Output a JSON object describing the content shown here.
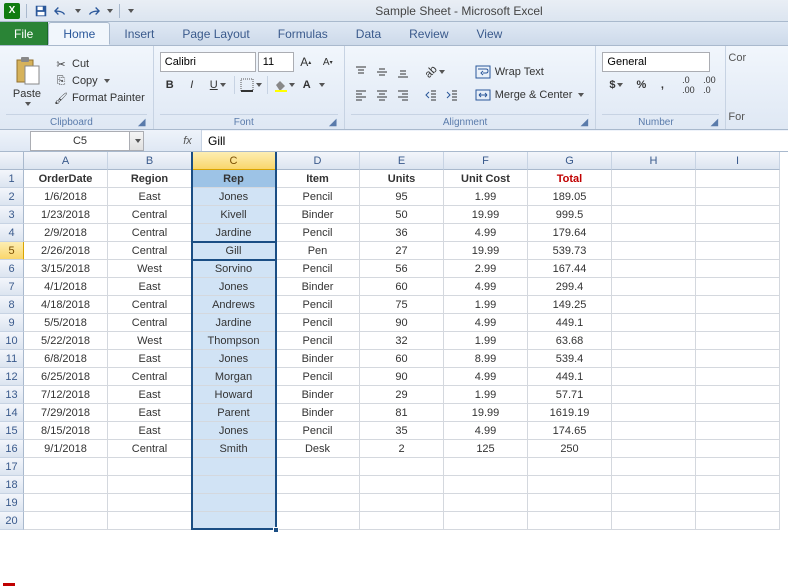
{
  "title": "Sample Sheet - Microsoft Excel",
  "tabs": {
    "file": "File",
    "items": [
      "Home",
      "Insert",
      "Page Layout",
      "Formulas",
      "Data",
      "Review",
      "View"
    ],
    "active": "Home"
  },
  "ribbon": {
    "clipboard": {
      "paste": "Paste",
      "cut": "Cut",
      "copy": "Copy",
      "format_painter": "Format Painter",
      "label": "Clipboard"
    },
    "font": {
      "name": "Calibri",
      "size": "11",
      "label": "Font"
    },
    "alignment": {
      "wrap": "Wrap Text",
      "merge": "Merge & Center",
      "label": "Alignment"
    },
    "number": {
      "format": "General",
      "label": "Number"
    }
  },
  "formula_bar": {
    "name_box": "C5",
    "fx": "fx",
    "value": "Gill"
  },
  "columns": [
    "A",
    "B",
    "C",
    "D",
    "E",
    "F",
    "G",
    "H",
    "I"
  ],
  "row_count": 20,
  "selected_col_index": 2,
  "active_cell": {
    "row": 5,
    "col": 2
  },
  "headers": [
    "OrderDate",
    "Region",
    "Rep",
    "Item",
    "Units",
    "Unit Cost",
    "Total"
  ],
  "total_header_red": true,
  "rows": [
    [
      "1/6/2018",
      "East",
      "Jones",
      "Pencil",
      "95",
      "1.99",
      "189.05"
    ],
    [
      "1/23/2018",
      "Central",
      "Kivell",
      "Binder",
      "50",
      "19.99",
      "999.5"
    ],
    [
      "2/9/2018",
      "Central",
      "Jardine",
      "Pencil",
      "36",
      "4.99",
      "179.64"
    ],
    [
      "2/26/2018",
      "Central",
      "Gill",
      "Pen",
      "27",
      "19.99",
      "539.73"
    ],
    [
      "3/15/2018",
      "West",
      "Sorvino",
      "Pencil",
      "56",
      "2.99",
      "167.44"
    ],
    [
      "4/1/2018",
      "East",
      "Jones",
      "Binder",
      "60",
      "4.99",
      "299.4"
    ],
    [
      "4/18/2018",
      "Central",
      "Andrews",
      "Pencil",
      "75",
      "1.99",
      "149.25"
    ],
    [
      "5/5/2018",
      "Central",
      "Jardine",
      "Pencil",
      "90",
      "4.99",
      "449.1"
    ],
    [
      "5/22/2018",
      "West",
      "Thompson",
      "Pencil",
      "32",
      "1.99",
      "63.68"
    ],
    [
      "6/8/2018",
      "East",
      "Jones",
      "Binder",
      "60",
      "8.99",
      "539.4"
    ],
    [
      "6/25/2018",
      "Central",
      "Morgan",
      "Pencil",
      "90",
      "4.99",
      "449.1"
    ],
    [
      "7/12/2018",
      "East",
      "Howard",
      "Binder",
      "29",
      "1.99",
      "57.71"
    ],
    [
      "7/29/2018",
      "East",
      "Parent",
      "Binder",
      "81",
      "19.99",
      "1619.19"
    ],
    [
      "8/15/2018",
      "East",
      "Jones",
      "Pencil",
      "35",
      "4.99",
      "174.65"
    ],
    [
      "9/1/2018",
      "Central",
      "Smith",
      "Desk",
      "2",
      "125",
      "250"
    ]
  ],
  "chart_data": {
    "type": "table",
    "columns": [
      "OrderDate",
      "Region",
      "Rep",
      "Item",
      "Units",
      "Unit Cost",
      "Total"
    ],
    "data": [
      {
        "OrderDate": "1/6/2018",
        "Region": "East",
        "Rep": "Jones",
        "Item": "Pencil",
        "Units": 95,
        "Unit Cost": 1.99,
        "Total": 189.05
      },
      {
        "OrderDate": "1/23/2018",
        "Region": "Central",
        "Rep": "Kivell",
        "Item": "Binder",
        "Units": 50,
        "Unit Cost": 19.99,
        "Total": 999.5
      },
      {
        "OrderDate": "2/9/2018",
        "Region": "Central",
        "Rep": "Jardine",
        "Item": "Pencil",
        "Units": 36,
        "Unit Cost": 4.99,
        "Total": 179.64
      },
      {
        "OrderDate": "2/26/2018",
        "Region": "Central",
        "Rep": "Gill",
        "Item": "Pen",
        "Units": 27,
        "Unit Cost": 19.99,
        "Total": 539.73
      },
      {
        "OrderDate": "3/15/2018",
        "Region": "West",
        "Rep": "Sorvino",
        "Item": "Pencil",
        "Units": 56,
        "Unit Cost": 2.99,
        "Total": 167.44
      },
      {
        "OrderDate": "4/1/2018",
        "Region": "East",
        "Rep": "Jones",
        "Item": "Binder",
        "Units": 60,
        "Unit Cost": 4.99,
        "Total": 299.4
      },
      {
        "OrderDate": "4/18/2018",
        "Region": "Central",
        "Rep": "Andrews",
        "Item": "Pencil",
        "Units": 75,
        "Unit Cost": 1.99,
        "Total": 149.25
      },
      {
        "OrderDate": "5/5/2018",
        "Region": "Central",
        "Rep": "Jardine",
        "Item": "Pencil",
        "Units": 90,
        "Unit Cost": 4.99,
        "Total": 449.1
      },
      {
        "OrderDate": "5/22/2018",
        "Region": "West",
        "Rep": "Thompson",
        "Item": "Pencil",
        "Units": 32,
        "Unit Cost": 1.99,
        "Total": 63.68
      },
      {
        "OrderDate": "6/8/2018",
        "Region": "East",
        "Rep": "Jones",
        "Item": "Binder",
        "Units": 60,
        "Unit Cost": 8.99,
        "Total": 539.4
      },
      {
        "OrderDate": "6/25/2018",
        "Region": "Central",
        "Rep": "Morgan",
        "Item": "Pencil",
        "Units": 90,
        "Unit Cost": 4.99,
        "Total": 449.1
      },
      {
        "OrderDate": "7/12/2018",
        "Region": "East",
        "Rep": "Howard",
        "Item": "Binder",
        "Units": 29,
        "Unit Cost": 1.99,
        "Total": 57.71
      },
      {
        "OrderDate": "7/29/2018",
        "Region": "East",
        "Rep": "Parent",
        "Item": "Binder",
        "Units": 81,
        "Unit Cost": 19.99,
        "Total": 1619.19
      },
      {
        "OrderDate": "8/15/2018",
        "Region": "East",
        "Rep": "Jones",
        "Item": "Pencil",
        "Units": 35,
        "Unit Cost": 4.99,
        "Total": 174.65
      },
      {
        "OrderDate": "9/1/2018",
        "Region": "Central",
        "Rep": "Smith",
        "Item": "Desk",
        "Units": 2,
        "Unit Cost": 125,
        "Total": 250
      }
    ]
  }
}
